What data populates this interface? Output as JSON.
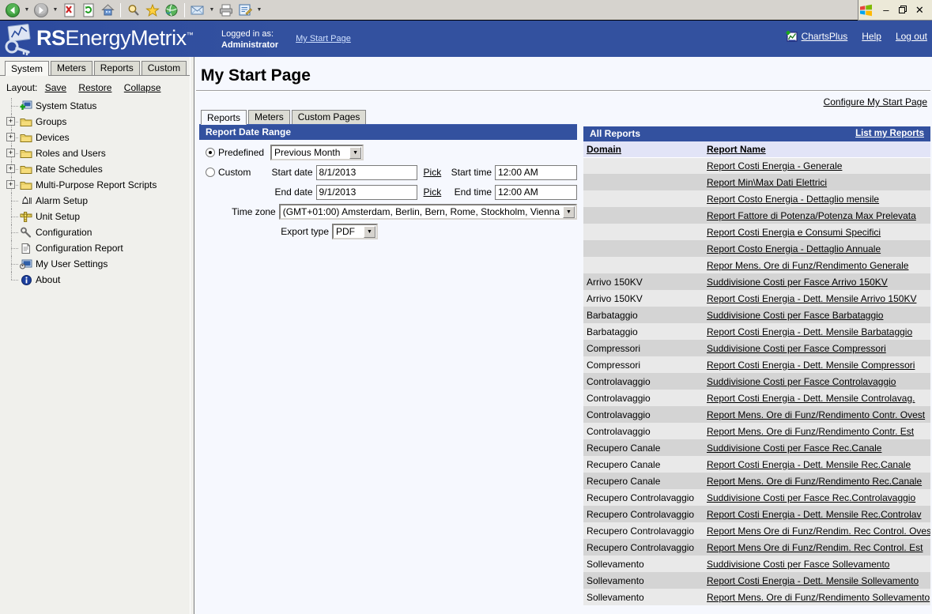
{
  "browser": {
    "toolbar_buttons": [
      {
        "name": "back-button",
        "icon": "back-arrow-icon",
        "has_caret": true
      },
      {
        "name": "forward-button",
        "icon": "forward-arrow-icon",
        "has_caret": true
      },
      {
        "name": "stop-button",
        "icon": "stop-icon",
        "has_caret": false
      },
      {
        "name": "refresh-button",
        "icon": "refresh-icon",
        "has_caret": false
      },
      {
        "name": "home-button",
        "icon": "home-icon",
        "has_caret": false
      },
      {
        "name": "search-button",
        "icon": "search-icon",
        "has_caret": false
      },
      {
        "name": "favorites-button",
        "icon": "star-icon",
        "has_caret": false
      },
      {
        "name": "history-button",
        "icon": "history-globe-icon",
        "has_caret": false
      },
      {
        "name": "mail-button",
        "icon": "mail-icon",
        "has_caret": true
      },
      {
        "name": "print-button",
        "icon": "printer-icon",
        "has_caret": false
      },
      {
        "name": "edit-button",
        "icon": "edit-page-icon",
        "has_caret": true
      }
    ],
    "window_controls": {
      "minimize": "–",
      "maximize": "❐",
      "close": "✕"
    }
  },
  "header": {
    "brand_bold": "RS",
    "brand_light": "EnergyMetrix",
    "brand_tm": "™",
    "logged_in_label": "Logged in as:",
    "logged_in_user": "Administrator",
    "my_start_page_link": "My Start Page",
    "charts_plus": "ChartsPlus",
    "help": "Help",
    "log_out": "Log out"
  },
  "sidebar": {
    "tabs": [
      {
        "label": "System",
        "active": true
      },
      {
        "label": "Meters",
        "active": false
      },
      {
        "label": "Reports",
        "active": false
      },
      {
        "label": "Custom",
        "active": false
      }
    ],
    "layout_label": "Layout:",
    "layout_links": [
      "Save",
      "Restore",
      "Collapse"
    ],
    "tree": [
      {
        "label": "System Status",
        "icon": "system-status-icon",
        "expandable": false
      },
      {
        "label": "Groups",
        "icon": "folder-icon",
        "expandable": true,
        "expander": "+"
      },
      {
        "label": "Devices",
        "icon": "folder-icon",
        "expandable": true,
        "expander": "+"
      },
      {
        "label": "Roles and Users",
        "icon": "folder-icon",
        "expandable": true,
        "expander": "+"
      },
      {
        "label": "Rate Schedules",
        "icon": "folder-icon",
        "expandable": true,
        "expander": "+"
      },
      {
        "label": "Multi-Purpose Report Scripts",
        "icon": "folder-icon",
        "expandable": true,
        "expander": "+"
      },
      {
        "label": "Alarm Setup",
        "icon": "alarm-bell-icon",
        "expandable": false
      },
      {
        "label": "Unit Setup",
        "icon": "ruler-icon",
        "expandable": false
      },
      {
        "label": "Configuration",
        "icon": "wrench-icon",
        "expandable": false
      },
      {
        "label": "Configuration Report",
        "icon": "document-icon",
        "expandable": false
      },
      {
        "label": "My User Settings",
        "icon": "user-settings-icon",
        "expandable": false
      },
      {
        "label": "About",
        "icon": "info-icon",
        "expandable": false
      }
    ]
  },
  "main": {
    "page_title": "My Start Page",
    "configure_link": "Configure My Start Page",
    "tabs": [
      {
        "label": "Reports",
        "active": true
      },
      {
        "label": "Meters",
        "active": false
      },
      {
        "label": "Custom Pages",
        "active": false
      }
    ],
    "date_range": {
      "panel_title": "Report Date Range",
      "predefined_label": "Predefined",
      "predefined_selected": true,
      "predefined_value": "Previous Month",
      "custom_label": "Custom",
      "custom_selected": false,
      "start_date_label": "Start date",
      "start_date_value": "8/1/2013",
      "start_pick_link": "Pick",
      "start_time_label": "Start time",
      "start_time_value": "12:00 AM",
      "end_date_label": "End date",
      "end_date_value": "9/1/2013",
      "end_pick_link": "Pick",
      "end_time_label": "End time",
      "end_time_value": "12:00 AM",
      "timezone_label": "Time zone",
      "timezone_value": "(GMT+01:00) Amsterdam, Berlin, Bern, Rome, Stockholm, Vienna",
      "export_type_label": "Export type",
      "export_type_value": "PDF"
    },
    "reports": {
      "panel_title": "All Reports",
      "list_my_reports_link": "List my Reports",
      "columns": [
        "Domain",
        "Report Name"
      ],
      "rows": [
        {
          "domain": "",
          "report": "Report Costi Energia - Generale"
        },
        {
          "domain": "",
          "report": "Report Min\\Max Dati Elettrici"
        },
        {
          "domain": "",
          "report": "Report Costo Energia - Dettaglio mensile"
        },
        {
          "domain": "",
          "report": "Report Fattore di Potenza/Potenza Max Prelevata"
        },
        {
          "domain": "",
          "report": "Report Costi Energia e Consumi Specifici"
        },
        {
          "domain": "",
          "report": "Report Costo Energia - Dettaglio Annuale"
        },
        {
          "domain": "",
          "report": "Repor Mens. Ore di Funz/Rendimento Generale"
        },
        {
          "domain": "Arrivo 150KV",
          "report": "Suddivisione Costi per Fasce Arrivo 150KV"
        },
        {
          "domain": "Arrivo 150KV",
          "report": "Report Costi Energia - Dett. Mensile Arrivo 150KV"
        },
        {
          "domain": "Barbataggio",
          "report": "Suddivisione Costi per Fasce Barbataggio"
        },
        {
          "domain": "Barbataggio",
          "report": "Report Costi Energia - Dett. Mensile Barbataggio"
        },
        {
          "domain": "Compressori",
          "report": "Suddivisione Costi per Fasce Compressori"
        },
        {
          "domain": "Compressori",
          "report": "Report Costi Energia - Dett. Mensile Compressori"
        },
        {
          "domain": "Controlavaggio",
          "report": "Suddivisione Costi per Fasce Controlavaggio"
        },
        {
          "domain": "Controlavaggio",
          "report": "Report Costi Energia - Dett. Mensile Controlavag."
        },
        {
          "domain": "Controlavaggio",
          "report": "Report Mens. Ore di Funz/Rendimento Contr. Ovest"
        },
        {
          "domain": "Controlavaggio",
          "report": "Report Mens. Ore di Funz/Rendimento Contr. Est"
        },
        {
          "domain": "Recupero Canale",
          "report": "Suddivisione Costi per Fasce Rec.Canale"
        },
        {
          "domain": "Recupero Canale",
          "report": "Report Costi Energia - Dett. Mensile Rec.Canale"
        },
        {
          "domain": "Recupero Canale",
          "report": "Report Mens. Ore di Funz/Rendimento Rec.Canale"
        },
        {
          "domain": "Recupero Controlavaggio",
          "report": "Suddivisione Costi per Fasce Rec.Controlavaggio"
        },
        {
          "domain": "Recupero Controlavaggio",
          "report": "Report Costi Energia - Dett. Mensile Rec.Controlav"
        },
        {
          "domain": "Recupero Controlavaggio",
          "report": "Report Mens Ore di Funz/Rendim. Rec Control. Ovest"
        },
        {
          "domain": "Recupero Controlavaggio",
          "report": "Report Mens Ore di Funz/Rendim. Rec Control. Est"
        },
        {
          "domain": "Sollevamento",
          "report": "Suddivisione Costi per Fasce Sollevamento"
        },
        {
          "domain": "Sollevamento",
          "report": "Report Costi Energia - Dett. Mensile Sollevamento"
        },
        {
          "domain": "Sollevamento",
          "report": "Report Mens. Ore di Funz/Rendimento Sollevamento"
        }
      ]
    }
  },
  "colors": {
    "brand_blue": "#33519f",
    "panel_header": "#33519f",
    "chrome_gray": "#d6d3ce",
    "row_odd": "#e9e9e9",
    "row_even": "#d4d4d4",
    "table_header": "#e2e4f7",
    "main_bg": "#f6f8fe"
  }
}
